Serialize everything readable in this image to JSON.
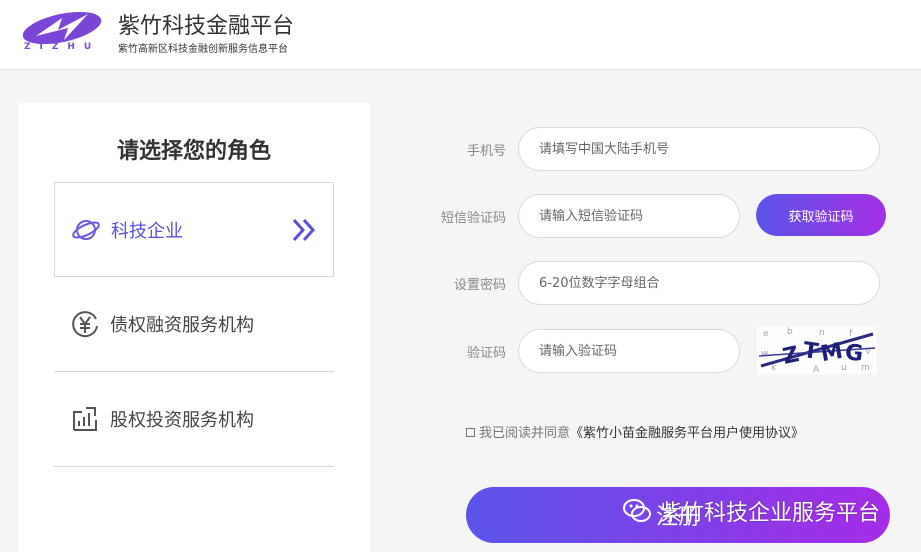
{
  "header": {
    "logo_letters": "ZIZHU",
    "title": "紫竹科技金融平台",
    "subtitle": "紫竹高新区科技金融创新服务信息平台"
  },
  "roles": {
    "title": "请选择您的角色",
    "items": [
      {
        "label": "科技企业",
        "icon": "planet-icon",
        "selected": true
      },
      {
        "label": "债权融资服务机构",
        "icon": "yen-coin-icon",
        "selected": false
      },
      {
        "label": "股权投资服务机构",
        "icon": "growth-chart-icon",
        "selected": false
      }
    ]
  },
  "form": {
    "phone": {
      "label": "手机号",
      "placeholder": "请填写中国大陆手机号"
    },
    "sms": {
      "label": "短信验证码",
      "placeholder": "请输入短信验证码",
      "button": "获取验证码"
    },
    "password": {
      "label": "设置密码",
      "placeholder": "6-20位数字字母组合"
    },
    "captcha": {
      "label": "验证码",
      "placeholder": "请输入验证码"
    },
    "agree": {
      "text": "我已阅读并同意",
      "link": "《紫竹小苗金融服务平台用户使用协议》"
    },
    "register_button": "注册"
  },
  "watermark": {
    "text": "紫竹科技企业服务平台",
    "icon": "wechat-icon"
  },
  "colors": {
    "accent_start": "#5a54ea",
    "accent_end": "#a62de8",
    "selected_text": "#5a4fd8"
  }
}
